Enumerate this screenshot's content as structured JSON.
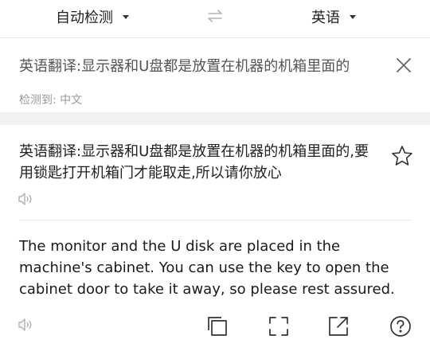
{
  "lang_bar": {
    "source_lang": "自动检测",
    "target_lang": "英语",
    "swap_icon": "swap-arrows-icon",
    "caret_icon": "caret-down-icon"
  },
  "input": {
    "text": "英语翻译:显示器和U盘都是放置在机器的机箱里面的",
    "detected": "检测到: 中文",
    "close_icon": "close-icon"
  },
  "result": {
    "source_text": "英语翻译:显示器和U盘都是放置在机器的机箱里面的,要用锁匙打开机箱门才能取走,所以请你放心",
    "translation": "The monitor and the U disk are placed in the machine's cabinet. You can use the key to open the cabinet door to take it away, so please rest assured.",
    "icons": [
      "star-icon",
      "speaker-icon",
      "copy-icon",
      "fullscreen-icon",
      "share-icon",
      "help-icon"
    ]
  },
  "colors": {
    "background": "#ffffff",
    "separator": "#f2f2f2",
    "text": "#222222",
    "muted": "#9a9a9a"
  }
}
